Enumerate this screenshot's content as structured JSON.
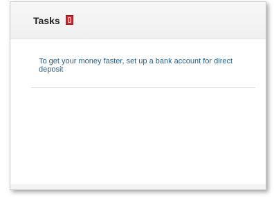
{
  "tasks": {
    "title": "Tasks",
    "badge_icon": "red-alert-badge-icon",
    "message": "To get your money faster, set up a bank account for direct deposit"
  },
  "colors": {
    "title": "#222222",
    "link": "#1f5f8f",
    "badge": "#d6262b"
  }
}
